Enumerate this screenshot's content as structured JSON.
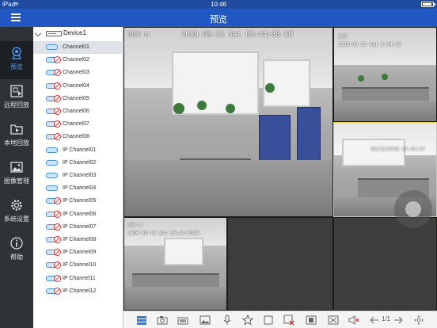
{
  "status_bar": {
    "carrier": "iPad",
    "time": "10:46"
  },
  "title_bar": {
    "title": "预览"
  },
  "nav": {
    "items": [
      {
        "label": "预览",
        "icon": "camera-icon",
        "active": true
      },
      {
        "label": "远程回放",
        "icon": "remote-playback-icon",
        "active": false
      },
      {
        "label": "本地回放",
        "icon": "local-playback-icon",
        "active": false
      },
      {
        "label": "图像管理",
        "icon": "image-icon",
        "active": false
      },
      {
        "label": "系统设置",
        "icon": "gear-icon",
        "active": false
      },
      {
        "label": "帮助",
        "icon": "info-icon",
        "active": false
      }
    ]
  },
  "device_tree": {
    "device_name": "Device1",
    "channels": [
      {
        "label": "Channel01",
        "online": true,
        "selected": true
      },
      {
        "label": "Channel02",
        "online": false
      },
      {
        "label": "Channel03",
        "online": false
      },
      {
        "label": "Channel04",
        "online": false
      },
      {
        "label": "Channel05",
        "online": false
      },
      {
        "label": "Channel06",
        "online": false
      },
      {
        "label": "Channel07",
        "online": false
      },
      {
        "label": "Channel08",
        "online": false
      },
      {
        "label": "IP Channel01",
        "online": true
      },
      {
        "label": "IP Channel02",
        "online": true
      },
      {
        "label": "IP Channel03",
        "online": true
      },
      {
        "label": "IP Channel04",
        "online": true
      },
      {
        "label": "IP Channel05",
        "online": false
      },
      {
        "label": "IP Channel06",
        "online": false
      },
      {
        "label": "IP Channel07",
        "online": false
      },
      {
        "label": "IP Channel08",
        "online": false
      },
      {
        "label": "IP Channel09",
        "online": false
      },
      {
        "label": "IP Channel10",
        "online": false
      },
      {
        "label": "IP Channel11",
        "online": false
      },
      {
        "label": "IP Channel12",
        "online": false
      }
    ]
  },
  "video": {
    "main": {
      "label": "300 m",
      "timestamp": "2016-08-13 Sat 05:44:38 AM"
    },
    "top_right": {
      "label": "100",
      "timestamp": "2016-08-13 Sat 5:44:32"
    },
    "mid_right": {
      "timestamp": "08/13/2016 05:44:37"
    },
    "bottom_left": {
      "label": "200 m",
      "timestamp": "2016-08-13 Sat 05:44:09AM"
    }
  },
  "toolbar": {
    "items": [
      {
        "icon": "layout-icon",
        "active": true
      },
      {
        "icon": "snapshot-icon"
      },
      {
        "icon": "record-icon"
      },
      {
        "icon": "picture-icon"
      },
      {
        "icon": "microphone-icon"
      },
      {
        "icon": "star-icon"
      },
      {
        "icon": "stop-icon"
      },
      {
        "icon": "close-all-icon"
      },
      {
        "icon": "stream-icon"
      },
      {
        "icon": "fullscreen-icon"
      },
      {
        "icon": "mute-icon"
      },
      {
        "icon": "prev-page-icon"
      },
      {
        "icon": "next-page-icon"
      },
      {
        "icon": "ptz-icon"
      }
    ],
    "page_indicator": "1/1"
  }
}
